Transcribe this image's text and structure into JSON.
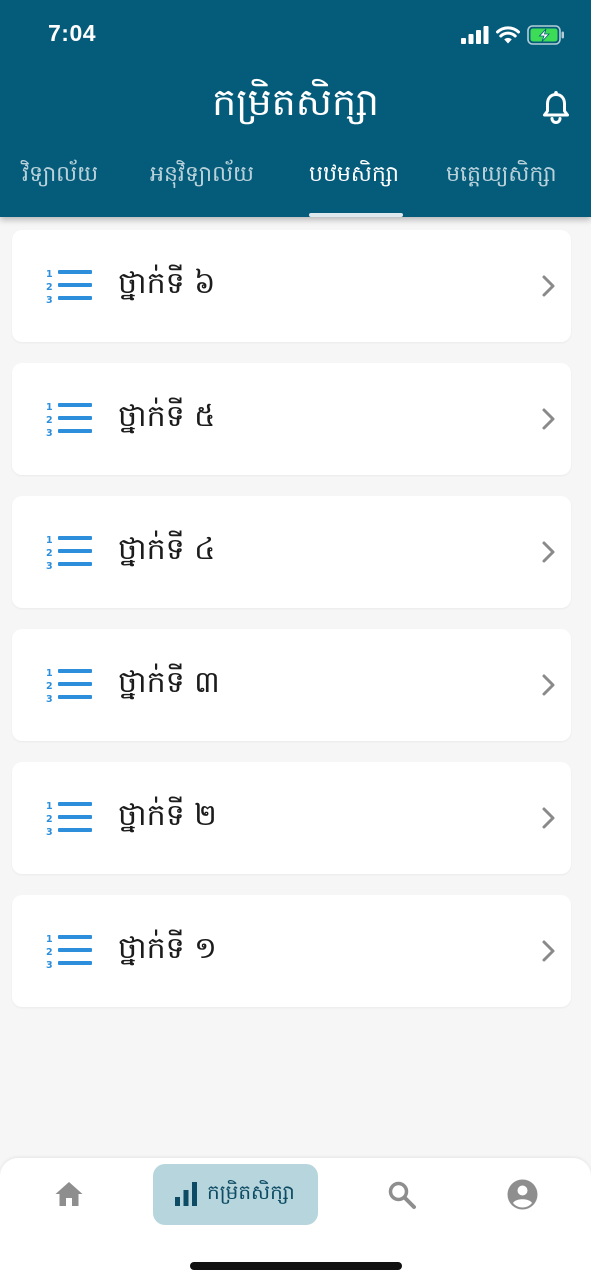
{
  "status_bar": {
    "time": "7:04"
  },
  "header": {
    "title": "កម្រិតសិក្សា"
  },
  "tabs": [
    {
      "label": "វិទ្យាល័យ",
      "active": false
    },
    {
      "label": "អនុវិទ្យាល័យ",
      "active": false
    },
    {
      "label": "បឋមសិក្សា",
      "active": true
    },
    {
      "label": "មត្តេយ្យសិក្សា",
      "active": false
    }
  ],
  "grades": [
    {
      "label": "ថ្នាក់ទី ៦"
    },
    {
      "label": "ថ្នាក់ទី ៥"
    },
    {
      "label": "ថ្នាក់ទី ៤"
    },
    {
      "label": "ថ្នាក់ទី ៣"
    },
    {
      "label": "ថ្នាក់ទី ២"
    },
    {
      "label": "ថ្នាក់ទី ១"
    }
  ],
  "bottom_nav": {
    "items": [
      {
        "icon": "home-icon",
        "label": "",
        "active": false
      },
      {
        "icon": "bar-chart-icon",
        "label": "កម្រិតសិក្សា",
        "active": true
      },
      {
        "icon": "search-icon",
        "label": "",
        "active": false
      },
      {
        "icon": "account-circle-icon",
        "label": "",
        "active": false
      }
    ]
  },
  "colors": {
    "brand": "#055c7a",
    "accent": "#2d8fdc",
    "nav_active_bg": "#b7d5dd",
    "battery_fill": "#3ddc57"
  }
}
